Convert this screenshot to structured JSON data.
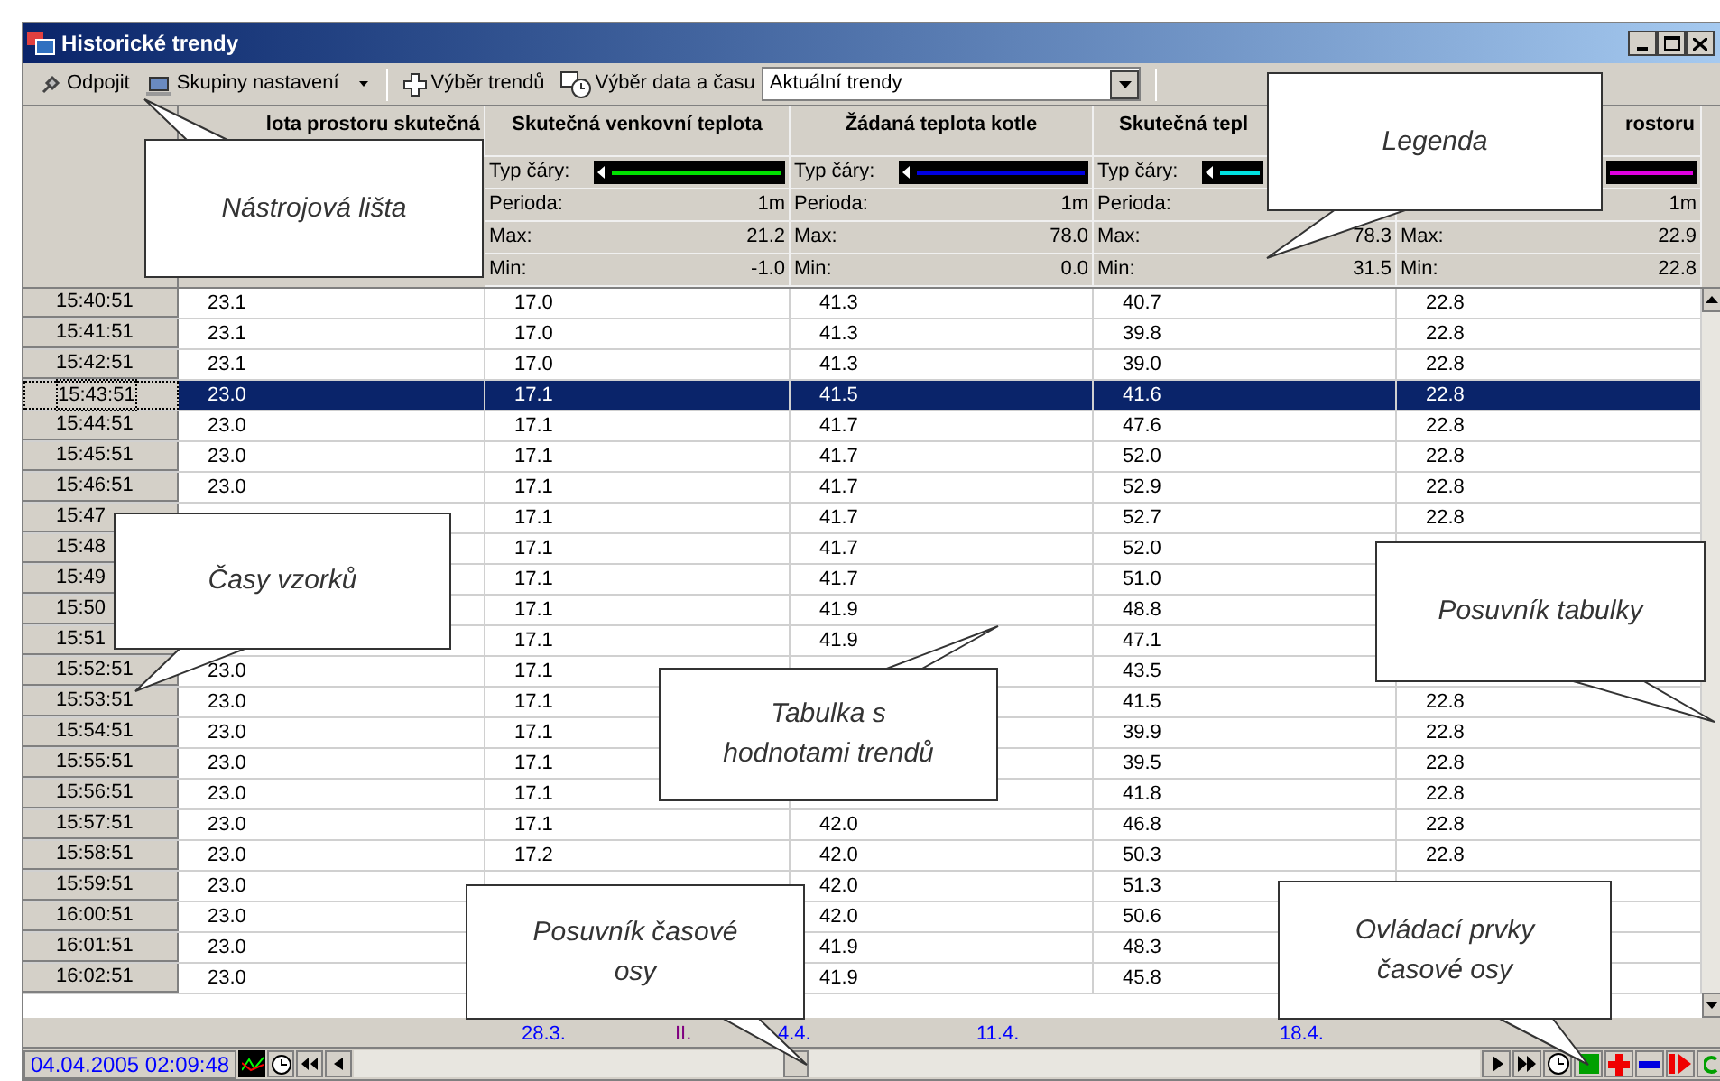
{
  "window": {
    "title": "Historické trendy"
  },
  "toolbar": {
    "items": [
      {
        "kind": "disconnect",
        "label": "Odpojit"
      },
      {
        "kind": "groups",
        "label": "Skupiny nastavení"
      },
      {
        "kind": "add",
        "label": "Výběr trendů"
      },
      {
        "kind": "datetime",
        "label": "Výběr data a času"
      }
    ],
    "select": {
      "value": "Aktuální trendy"
    }
  },
  "legend": {
    "columns": [
      {
        "header": "lota prostoru skutečná"
      },
      {
        "header": "Skutečná venkovní teplota",
        "line_label": "Typ čáry:",
        "color": "#00e000",
        "perioda_label": "Perioda:",
        "perioda": "1m",
        "max_label": "Max:",
        "max": "21.2",
        "min_label": "Min:",
        "min": "-1.0"
      },
      {
        "header": "Žádaná teplota kotle",
        "line_label": "Typ čáry:",
        "color": "#0000e0",
        "perioda_label": "Perioda:",
        "perioda": "1m",
        "max_label": "Max:",
        "max": "78.0",
        "min_label": "Min:",
        "min": "0.0"
      },
      {
        "header": "Skutečná tepl",
        "line_label": "Typ čáry:",
        "color": "#00e0e0",
        "perioda_label": "Perioda:",
        "max_label": "Max:",
        "max": "78.3",
        "min_label": "Min:",
        "min": "31.5"
      },
      {
        "header": "rostoru",
        "color": "#e000e0",
        "perioda": "1m",
        "max_label": "Max:",
        "max": "22.9",
        "min_label": "Min:",
        "min": "22.8"
      }
    ]
  },
  "table": {
    "rows": [
      {
        "time": "15:40:51",
        "selected": false,
        "cells": [
          "23.1",
          "17.0",
          "41.3",
          "40.7",
          "22.8"
        ]
      },
      {
        "time": "15:41:51",
        "selected": false,
        "cells": [
          "23.1",
          "17.0",
          "41.3",
          "39.8",
          "22.8"
        ]
      },
      {
        "time": "15:42:51",
        "selected": false,
        "cells": [
          "23.1",
          "17.0",
          "41.3",
          "39.0",
          "22.8"
        ]
      },
      {
        "time": "15:43:51",
        "selected": true,
        "cells": [
          "23.0",
          "17.1",
          "41.5",
          "41.6",
          "22.8"
        ]
      },
      {
        "time": "15:44:51",
        "selected": false,
        "cells": [
          "23.0",
          "17.1",
          "41.7",
          "47.6",
          "22.8"
        ]
      },
      {
        "time": "15:45:51",
        "selected": false,
        "cells": [
          "23.0",
          "17.1",
          "41.7",
          "52.0",
          "22.8"
        ]
      },
      {
        "time": "15:46:51",
        "selected": false,
        "cells": [
          "23.0",
          "17.1",
          "41.7",
          "52.9",
          "22.8"
        ]
      },
      {
        "time": "15:47",
        "selected": false,
        "cells": [
          null,
          "17.1",
          "41.7",
          "52.7",
          "22.8"
        ]
      },
      {
        "time": "15:48",
        "selected": false,
        "cells": [
          null,
          "17.1",
          "41.7",
          "52.0",
          null
        ]
      },
      {
        "time": "15:49",
        "selected": false,
        "cells": [
          null,
          "17.1",
          "41.7",
          "51.0",
          null
        ]
      },
      {
        "time": "15:50",
        "selected": false,
        "cells": [
          null,
          "17.1",
          "41.9",
          "48.8",
          null
        ]
      },
      {
        "time": "15:51",
        "selected": false,
        "cells": [
          null,
          "17.1",
          "41.9",
          "47.1",
          null
        ]
      },
      {
        "time": "15:52:51",
        "selected": false,
        "cells": [
          "23.0",
          "17.1",
          null,
          "43.5",
          null
        ]
      },
      {
        "time": "15:53:51",
        "selected": false,
        "cells": [
          "23.0",
          "17.1",
          null,
          "41.5",
          "22.8"
        ]
      },
      {
        "time": "15:54:51",
        "selected": false,
        "cells": [
          "23.0",
          "17.1",
          null,
          "39.9",
          "22.8"
        ]
      },
      {
        "time": "15:55:51",
        "selected": false,
        "cells": [
          "23.0",
          "17.1",
          null,
          "39.5",
          "22.8"
        ]
      },
      {
        "time": "15:56:51",
        "selected": false,
        "cells": [
          "23.0",
          "17.1",
          null,
          "41.8",
          "22.8"
        ]
      },
      {
        "time": "15:57:51",
        "selected": false,
        "cells": [
          "23.0",
          "17.1",
          "42.0",
          "46.8",
          "22.8"
        ]
      },
      {
        "time": "15:58:51",
        "selected": false,
        "cells": [
          "23.0",
          "17.2",
          "42.0",
          "50.3",
          "22.8"
        ]
      },
      {
        "time": "15:59:51",
        "selected": false,
        "cells": [
          "23.0",
          null,
          "42.0",
          "51.3",
          null
        ]
      },
      {
        "time": "16:00:51",
        "selected": false,
        "cells": [
          "23.0",
          null,
          "42.0",
          "50.6",
          null
        ]
      },
      {
        "time": "16:01:51",
        "selected": false,
        "cells": [
          "23.0",
          null,
          "41.9",
          "48.3",
          null
        ]
      },
      {
        "time": "16:02:51",
        "selected": false,
        "cells": [
          "23.0",
          null,
          "41.9",
          "45.8",
          null
        ]
      }
    ]
  },
  "timeline": {
    "labels": [
      {
        "text": "28.3.",
        "color": "#0000ff"
      },
      {
        "text": "II.",
        "color": "#800080"
      },
      {
        "text": "4.4.",
        "color": "#0000ff"
      },
      {
        "text": "11.4.",
        "color": "#0000ff"
      },
      {
        "text": "18.4.",
        "color": "#0000ff"
      }
    ]
  },
  "status": {
    "datetime": "04.04.2005 02:09:48"
  },
  "controls": [
    {
      "kind": "play"
    },
    {
      "kind": "fast-forward"
    },
    {
      "kind": "clock"
    },
    {
      "kind": "stop"
    },
    {
      "kind": "zoom-in"
    },
    {
      "kind": "zoom-out"
    },
    {
      "kind": "step"
    },
    {
      "kind": "refresh"
    }
  ],
  "callouts": [
    {
      "text": "Nástrojová lišta"
    },
    {
      "text": "Legenda"
    },
    {
      "text": "Časy vzorků"
    },
    {
      "text": "Tabulka s hodnotami trendů"
    },
    {
      "text": "Posuvník tabulky"
    },
    {
      "text": "Posuvník časové osy"
    },
    {
      "text": "Ovládací prvky časové osy"
    }
  ]
}
